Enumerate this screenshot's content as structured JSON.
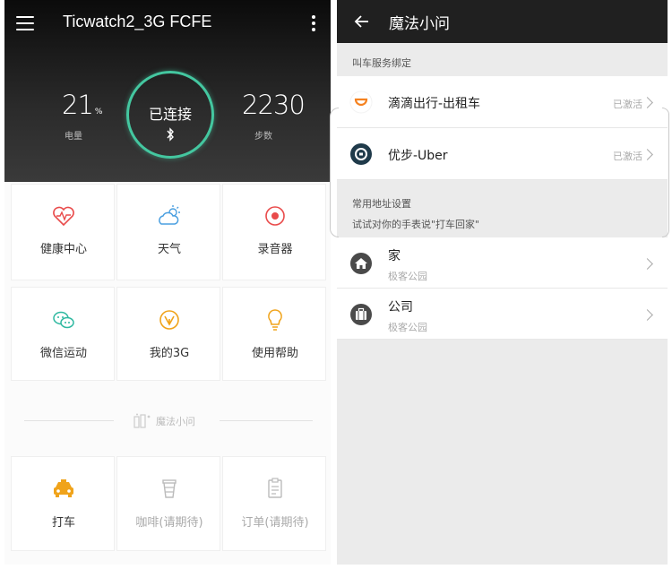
{
  "left": {
    "title": "Ticwatch2_3G FCFE",
    "battery": {
      "value": "21",
      "unit": "%",
      "label": "电量"
    },
    "connection": {
      "status": "已连接"
    },
    "steps": {
      "value": "2230",
      "label": "步数"
    },
    "apps": [
      {
        "label": "健康中心",
        "icon": "heart-pulse-icon",
        "color": "#e94b4b"
      },
      {
        "label": "天气",
        "icon": "cloud-sun-icon",
        "color": "#4a9fe0"
      },
      {
        "label": "录音器",
        "icon": "record-icon",
        "color": "#e94b4b"
      },
      {
        "label": "微信运动",
        "icon": "wechat-icon",
        "color": "#2eb8a0"
      },
      {
        "label": "我的3G",
        "icon": "signal-icon",
        "color": "#f0a31a"
      },
      {
        "label": "使用帮助",
        "icon": "lightbulb-icon",
        "color": "#f0a31a"
      }
    ],
    "section_label": "魔法小问",
    "magic_apps": [
      {
        "label": "打车",
        "icon": "taxi-icon",
        "color": "#f0a31a"
      },
      {
        "label": "咖啡(请期待)",
        "icon": "coffee-cup-icon",
        "color": "#bbbbbb"
      },
      {
        "label": "订单(请期待)",
        "icon": "order-list-icon",
        "color": "#bbbbbb"
      }
    ]
  },
  "right": {
    "title": "魔法小问",
    "service_section": "叫车服务绑定",
    "services": [
      {
        "name": "滴滴出行-出租车",
        "status": "已激活",
        "icon": "didi-icon",
        "color": "#f58220"
      },
      {
        "name": "优步-Uber",
        "status": "已激活",
        "icon": "uber-icon",
        "color": "#1f3a4a"
      }
    ],
    "address_section": "常用地址设置",
    "address_hint": "试试对你的手表说\"打车回家\"",
    "addresses": [
      {
        "name": "家",
        "detail": "极客公园",
        "icon": "home-icon"
      },
      {
        "name": "公司",
        "detail": "极客公园",
        "icon": "briefcase-icon"
      }
    ]
  }
}
